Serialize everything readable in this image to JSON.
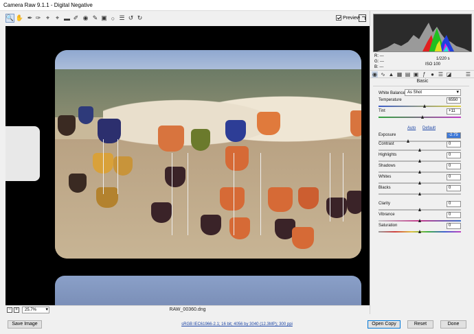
{
  "window": {
    "title": "Camera Raw 9.1.1  -  Digital Negative"
  },
  "toolbar": {
    "tools": [
      {
        "name": "zoom-tool",
        "icon": "magnifier"
      },
      {
        "name": "hand-tool",
        "icon": "hand"
      },
      {
        "name": "white-balance-tool",
        "icon": "eyedropper"
      },
      {
        "name": "color-sampler-tool",
        "icon": "eyedropper-target"
      },
      {
        "name": "targeted-adjustment-tool",
        "icon": "target"
      },
      {
        "name": "crop-tool",
        "icon": "crop"
      },
      {
        "name": "straighten-tool",
        "icon": "level"
      },
      {
        "name": "spot-removal-tool",
        "icon": "brush"
      },
      {
        "name": "red-eye-tool",
        "icon": "eye"
      },
      {
        "name": "adjustment-brush-tool",
        "icon": "brush"
      },
      {
        "name": "graduated-filter-tool",
        "icon": "gradient"
      },
      {
        "name": "radial-filter-tool",
        "icon": "circle"
      },
      {
        "name": "preferences-tool",
        "icon": "list"
      },
      {
        "name": "rotate-ccw-tool",
        "icon": "rotate-left"
      },
      {
        "name": "rotate-cw-tool",
        "icon": "rotate-right"
      }
    ],
    "preview_label": "Preview"
  },
  "preview": {
    "zoom_value": "25.7%",
    "filename": "RAW_00360.dng"
  },
  "histogram": {
    "rgb": {
      "r_label": "R:",
      "r_value": "---",
      "g_label": "G:",
      "g_value": "---",
      "b_label": "B:",
      "b_value": "---"
    },
    "shutter": "1/220 s",
    "iso": "ISO 100"
  },
  "basic_panel": {
    "title": "Basic",
    "white_balance_label": "White Balance:",
    "white_balance_value": "As Shot",
    "auto_label": "Auto",
    "default_label": "Default",
    "rows": [
      {
        "key": "temperature",
        "label": "Temperature",
        "value": "6550",
        "level": 0.56
      },
      {
        "key": "tint",
        "label": "Tint",
        "value": "+11",
        "level": 0.54
      },
      {
        "key": "exposure",
        "label": "Exposure",
        "value": "-2.75",
        "level": 0.36
      },
      {
        "key": "contrast",
        "label": "Contrast",
        "value": "0",
        "level": 0.5
      },
      {
        "key": "highlights",
        "label": "Highlights",
        "value": "0",
        "level": 0.5
      },
      {
        "key": "shadows",
        "label": "Shadows",
        "value": "0",
        "level": 0.5
      },
      {
        "key": "whites",
        "label": "Whites",
        "value": "0",
        "level": 0.5
      },
      {
        "key": "blacks",
        "label": "Blacks",
        "value": "0",
        "level": 0.5
      },
      {
        "key": "clarity",
        "label": "Clarity",
        "value": "0",
        "level": 0.5
      },
      {
        "key": "vibrance",
        "label": "Vibrance",
        "value": "0",
        "level": 0.5
      },
      {
        "key": "saturation",
        "label": "Saturation",
        "value": "0",
        "level": 0.5
      }
    ]
  },
  "bottom": {
    "save_label": "Save Image",
    "workflow_link": "sRGB IEC61966-2.1; 16 bit; 4056 by 3040 (12.3MP); 300 ppi",
    "open_label": "Open Copy",
    "reset_label": "Reset",
    "done_label": "Done"
  },
  "colors": {
    "accent": "#0078d7",
    "selection": "#3d78d8",
    "link": "#1c45a5"
  }
}
